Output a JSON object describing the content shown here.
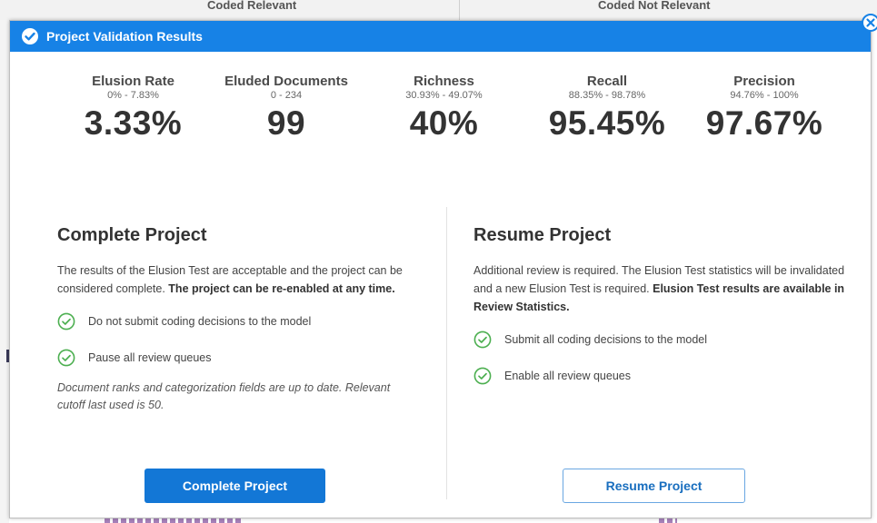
{
  "background": {
    "col1": "Coded Relevant",
    "col2": "Coded Not Relevant"
  },
  "modal": {
    "title": "Project Validation Results",
    "header_icon": "check-circle-icon",
    "close_icon": "close-icon"
  },
  "stats": [
    {
      "label": "Elusion Rate",
      "range": "0% - 7.83%",
      "value": "3.33%"
    },
    {
      "label": "Eluded Documents",
      "range": "0 - 234",
      "value": "99"
    },
    {
      "label": "Richness",
      "range": "30.93% - 49.07%",
      "value": "40%"
    },
    {
      "label": "Recall",
      "range": "88.35% - 98.78%",
      "value": "95.45%"
    },
    {
      "label": "Precision",
      "range": "94.76% - 100%",
      "value": "97.67%"
    }
  ],
  "complete": {
    "title": "Complete Project",
    "desc_normal": "The results of the Elusion Test are acceptable and the project can be considered complete. ",
    "desc_bold": "The project can be re-enabled at any time.",
    "items": [
      "Do not submit coding decisions to the model",
      "Pause all review queues"
    ],
    "note": "Document ranks and categorization fields are up to date. Relevant cutoff last used is 50.",
    "button": "Complete Project"
  },
  "resume": {
    "title": "Resume Project",
    "desc_normal": "Additional review is required. The Elusion Test statistics will be invalidated and a new Elusion Test is required. ",
    "desc_bold": "Elusion Test results are available in Review Statistics.",
    "items": [
      "Submit all coding decisions to the model",
      "Enable all review queues"
    ],
    "button": "Resume Project"
  },
  "colors": {
    "header": "#1782e6",
    "primary_button": "#1377d6",
    "check_green": "#4caf50"
  }
}
